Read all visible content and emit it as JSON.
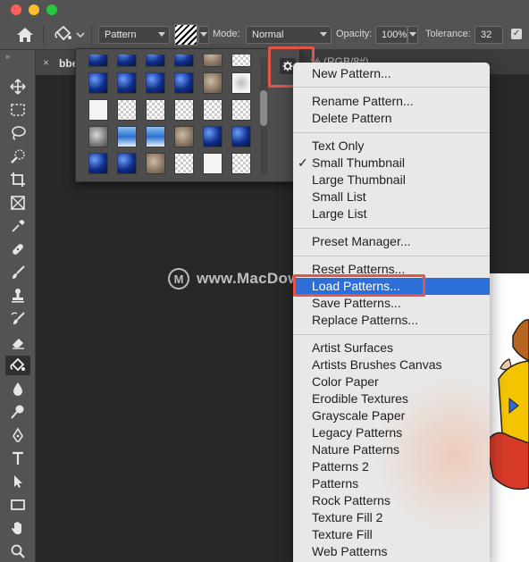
{
  "options_bar": {
    "fill_source": "Pattern",
    "mode_label": "Mode:",
    "mode_value": "Normal",
    "opacity_label": "Opacity:",
    "opacity_value": "100%",
    "tolerance_label": "Tolerance:",
    "tolerance_value": "32",
    "checkbox_checked": "✓"
  },
  "document": {
    "tab_close": "×",
    "tab_name": "bbe",
    "tab_mode": "% (RGB/8#)"
  },
  "watermark": {
    "logo": "M",
    "text": "www.MacDown.com"
  },
  "menu": {
    "new_pattern": "New Pattern...",
    "rename_pattern": "Rename Pattern...",
    "delete_pattern": "Delete Pattern",
    "text_only": "Text Only",
    "small_thumbnail": "Small Thumbnail",
    "small_thumbnail_check": "✓",
    "large_thumbnail": "Large Thumbnail",
    "small_list": "Small List",
    "large_list": "Large List",
    "preset_manager": "Preset Manager...",
    "reset_patterns": "Reset Patterns...",
    "load_patterns": "Load Patterns...",
    "save_patterns": "Save Patterns...",
    "replace_patterns": "Replace Patterns...",
    "libraries": [
      "Artist Surfaces",
      "Artists Brushes Canvas",
      "Color Paper",
      "Erodible Textures",
      "Grayscale Paper",
      "Legacy Patterns",
      "Nature Patterns",
      "Patterns 2",
      "Patterns",
      "Rock Patterns",
      "Texture Fill 2",
      "Texture Fill",
      "Web Patterns"
    ]
  },
  "colors": {
    "panel_bg": "#535353",
    "canvas_bg": "#282828",
    "menu_bg": "#e8e8e8",
    "menu_selected": "#2d6fd8",
    "highlight_outline": "#e0574a"
  },
  "icons": [
    "home-icon",
    "paint-bucket-icon",
    "gear-icon",
    "move-icon",
    "marquee-icon",
    "lasso-icon",
    "quick-select-icon",
    "crop-icon",
    "frame-icon",
    "eyedropper-icon",
    "healing-brush-icon",
    "brush-icon",
    "clone-stamp-icon",
    "history-brush-icon",
    "eraser-icon",
    "blur-icon",
    "dodge-icon",
    "pen-icon",
    "type-icon",
    "path-select-icon",
    "rectangle-icon",
    "hand-icon",
    "zoom-icon"
  ]
}
